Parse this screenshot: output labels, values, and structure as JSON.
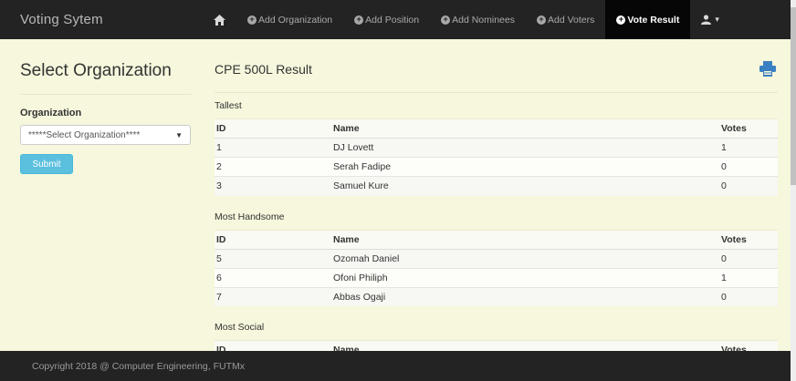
{
  "navbar": {
    "brand": "Voting Sytem",
    "items": [
      {
        "label": "Add Organization",
        "icon": "plus-circle-icon"
      },
      {
        "label": "Add Position",
        "icon": "plus-circle-icon"
      },
      {
        "label": "Add Nominees",
        "icon": "plus-circle-icon"
      },
      {
        "label": "Add Voters",
        "icon": "plus-circle-icon"
      },
      {
        "label": "Vote Result",
        "icon": "plus-circle-icon",
        "active": true
      }
    ],
    "home_icon": "home-icon",
    "user_icon": "user-icon",
    "user_caret": "▾"
  },
  "sidebar": {
    "title": "Select Organization",
    "label": "Organization",
    "select_value": "*****Select Organization****",
    "submit_label": "Submit"
  },
  "main": {
    "title": "CPE 500L Result",
    "print_icon": "print-icon",
    "columns": {
      "id": "ID",
      "name": "Name",
      "votes": "Votes"
    },
    "sections": [
      {
        "title": "Tallest",
        "rows": [
          {
            "id": "1",
            "name": "DJ Lovett",
            "votes": "1"
          },
          {
            "id": "2",
            "name": "Serah Fadipe",
            "votes": "0"
          },
          {
            "id": "3",
            "name": "Samuel Kure",
            "votes": "0"
          }
        ]
      },
      {
        "title": "Most Handsome",
        "rows": [
          {
            "id": "5",
            "name": "Ozomah Daniel",
            "votes": "0"
          },
          {
            "id": "6",
            "name": "Ofoni Philiph",
            "votes": "1"
          },
          {
            "id": "7",
            "name": "Abbas Ogaji",
            "votes": "0"
          }
        ]
      },
      {
        "title": "Most Social",
        "rows": []
      }
    ]
  },
  "footer": {
    "text": "Copyright 2018 @ Computer Engineering, FUTMx"
  },
  "colors": {
    "navbar": "#232323",
    "navbar_active": "#060606",
    "page_background": "#f6f7dc",
    "submit_button": "#5bc0de",
    "print_icon": "#3a7fc1"
  }
}
